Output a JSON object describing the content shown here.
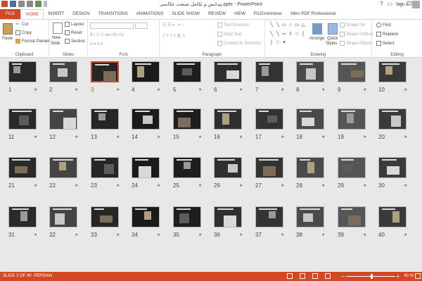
{
  "window": {
    "title": "پیدایش و تکامل صنعت عکاسی.pptx - PowerPoint",
    "help": "?",
    "controls": [
      "▭",
      "—",
      "❐",
      "✕"
    ]
  },
  "tabs": [
    {
      "label": "FILE"
    },
    {
      "label": "HOME"
    },
    {
      "label": "INSERT"
    },
    {
      "label": "DESIGN"
    },
    {
      "label": "TRANSITIONS"
    },
    {
      "label": "ANIMATIONS"
    },
    {
      "label": "SLIDE SHOW"
    },
    {
      "label": "REVIEW"
    },
    {
      "label": "VIEW"
    },
    {
      "label": "FILEminimizer"
    },
    {
      "label": "Nitro PDF Professional"
    }
  ],
  "signin": "Sign in",
  "ribbon": {
    "clipboard": {
      "paste": "Paste",
      "cut": "Cut",
      "copy": "Copy",
      "format_painter": "Format Painter",
      "label": "Clipboard"
    },
    "slides": {
      "new_slide": "New",
      "new_slide2": "Slide",
      "layout": "Layout",
      "reset": "Reset",
      "section": "Section",
      "label": "Slides"
    },
    "font": {
      "label": "Font"
    },
    "paragraph": {
      "text_direction": "Text Direction",
      "align_text": "Align Text",
      "convert_smartart": "Convert to SmartArt",
      "label": "Paragraph"
    },
    "drawing": {
      "arrange": "Arrange",
      "quick_styles": "Quick",
      "quick_styles2": "Styles",
      "shape_fill": "Shape Fill",
      "shape_outline": "Shape Outline",
      "shape_effects": "Shape Effects",
      "label": "Drawing"
    },
    "editing": {
      "find": "Find",
      "replace": "Replace",
      "select": "Select",
      "label": "Editing"
    }
  },
  "slides": [
    {
      "num": "1"
    },
    {
      "num": "2"
    },
    {
      "num": "3"
    },
    {
      "num": "4"
    },
    {
      "num": "5"
    },
    {
      "num": "6"
    },
    {
      "num": "7"
    },
    {
      "num": "8"
    },
    {
      "num": "9"
    },
    {
      "num": "10"
    },
    {
      "num": "11"
    },
    {
      "num": "12"
    },
    {
      "num": "13"
    },
    {
      "num": "14"
    },
    {
      "num": "15"
    },
    {
      "num": "16"
    },
    {
      "num": "17"
    },
    {
      "num": "18"
    },
    {
      "num": "19"
    },
    {
      "num": "20"
    },
    {
      "num": "21"
    },
    {
      "num": "22"
    },
    {
      "num": "23"
    },
    {
      "num": "24"
    },
    {
      "num": "25"
    },
    {
      "num": "26"
    },
    {
      "num": "27"
    },
    {
      "num": "28"
    },
    {
      "num": "29"
    },
    {
      "num": "30"
    },
    {
      "num": "31"
    },
    {
      "num": "32"
    },
    {
      "num": "33"
    },
    {
      "num": "34"
    },
    {
      "num": "35"
    },
    {
      "num": "36"
    },
    {
      "num": "37"
    },
    {
      "num": "38"
    },
    {
      "num": "39"
    },
    {
      "num": "40"
    }
  ],
  "selected_slide": 3,
  "star_glyph": "★",
  "status": {
    "slide_counter": "SLIDE 3 OF 40",
    "language": "PERSIAN",
    "zoom": "40 %",
    "zoom_minus": "−",
    "zoom_plus": "+"
  },
  "colors": {
    "accent": "#d24726"
  }
}
